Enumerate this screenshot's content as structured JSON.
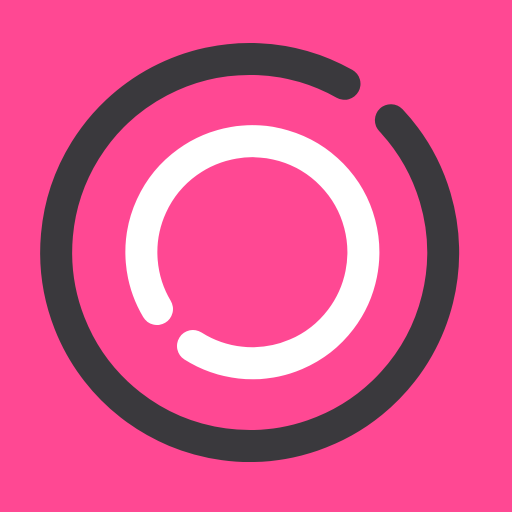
{
  "icon": {
    "name": "concentric-rings-logo",
    "colors": {
      "background": "#FF4893",
      "outer_ring": "#3A393D",
      "inner_ring": "#FFFFFF"
    }
  }
}
